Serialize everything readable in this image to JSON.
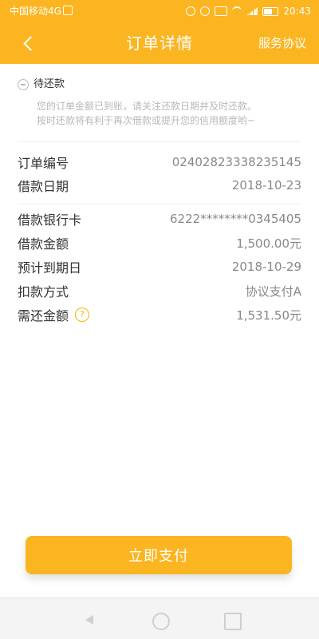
{
  "status_bar": {
    "carrier": "中国移动4G",
    "time": "20:43",
    "icons": [
      "hd-icon",
      "mute-icon",
      "alarm-icon",
      "nfc-icon",
      "wifi-icon",
      "signal-icon",
      "battery-icon"
    ]
  },
  "nav": {
    "back_icon": "chevron-left-icon",
    "title": "订单详情",
    "right_link": "服务协议"
  },
  "order_status": {
    "icon": "pending-icon",
    "label": "待还款",
    "notice_line1": "您的订单金额已到账，请关注还款日期并及时还款。",
    "notice_line2": "按时还款将有利于再次借款或提升您的信用额度哟~"
  },
  "details": {
    "order_no": {
      "label": "订单编号",
      "value": "02402823338235145"
    },
    "loan_date": {
      "label": "借款日期",
      "value": "2018-10-23"
    },
    "bank_card": {
      "label": "借款银行卡",
      "value": "6222********0345405"
    },
    "loan_amount": {
      "label": "借款金额",
      "value": "1,500.00元"
    },
    "due_date": {
      "label": "预计到期日",
      "value": "2018-10-29"
    },
    "deduction_method": {
      "label": "扣款方式",
      "value": "协议支付A"
    },
    "repay_amount": {
      "label": "需还金额",
      "value": "1,531.50元",
      "help_icon": "question-circle-icon",
      "help_glyph": "?"
    }
  },
  "pay_button": {
    "label": "立即支付"
  },
  "colors": {
    "accent": "#FAB521",
    "text_primary": "#333333",
    "text_secondary": "#888888",
    "notice": "#B8B8B8"
  },
  "system_nav": {
    "back_icon": "triangle-back-icon",
    "home_icon": "circle-home-icon",
    "recent_icon": "square-recent-icon"
  }
}
